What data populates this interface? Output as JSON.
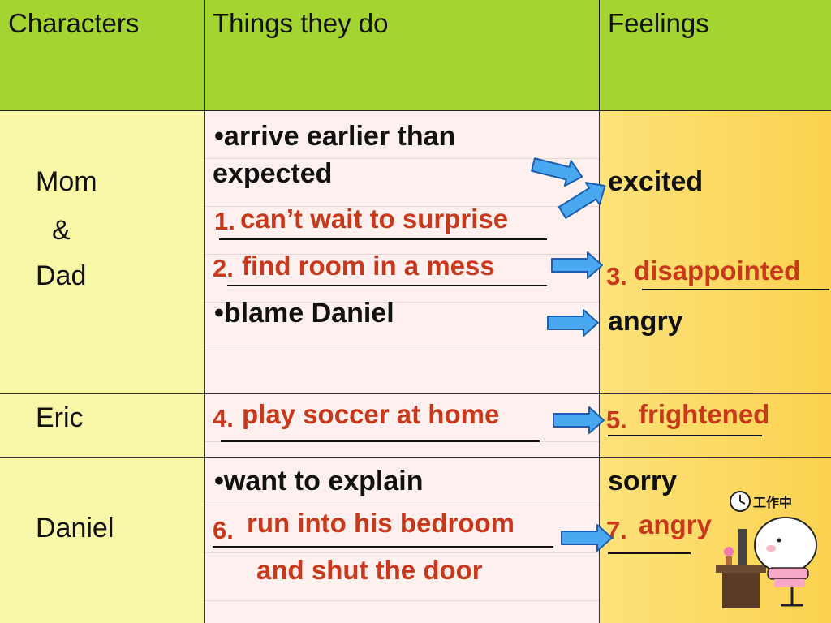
{
  "headers": {
    "characters": "Characters",
    "things": "Things they do",
    "feelings": "Feelings"
  },
  "rows": {
    "parents": {
      "names": [
        "Mom",
        "&",
        "Dad"
      ],
      "things": {
        "bullet1_line1": "•arrive earlier than",
        "bullet1_line2": "expected",
        "n1": "1.",
        "a1": "can’t wait to surprise",
        "n2": "2.",
        "a2": "find room in a mess",
        "bullet2": "•blame Daniel"
      },
      "feelings": {
        "f1": "excited",
        "n3": "3.",
        "a3": "disappointed",
        "f2": "angry"
      }
    },
    "eric": {
      "name": "Eric",
      "things": {
        "n4": "4.",
        "a4": "play soccer at home"
      },
      "feelings": {
        "n5": "5.",
        "a5": "frightened"
      }
    },
    "daniel": {
      "name": "Daniel",
      "things": {
        "bullet": "•want to explain",
        "n6": "6.",
        "a6_line1": "run into his bedroom",
        "a6_line2": "and shut the door"
      },
      "feelings": {
        "f1": "sorry",
        "n7": "7.",
        "a7": "angry"
      }
    }
  },
  "sticker": {
    "label": "工作中"
  },
  "colors": {
    "header": "#a4d432",
    "characters": "#f9f7a8",
    "things": "#fdf0ee",
    "feelings": "#fbd24f",
    "answer": "#c8391b",
    "arrow": "#4aa8f0"
  }
}
